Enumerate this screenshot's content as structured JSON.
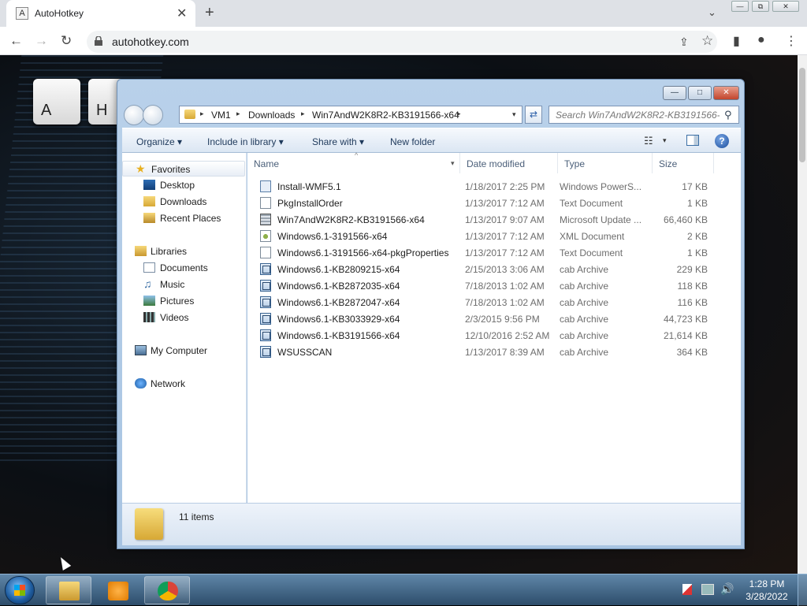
{
  "browser": {
    "tab": {
      "favicon": "A",
      "title": "AutoHotkey",
      "close": "✕"
    },
    "new_tab": "+",
    "tab_search": "⌄",
    "window_controls": {
      "minimize": "—",
      "maximize": "⧉",
      "close": "✕"
    },
    "nav": {
      "back": "←",
      "forward": "→",
      "reload": "↻"
    },
    "url": "autohotkey.com",
    "icons": {
      "share": "⇪",
      "star": "☆",
      "sidepanel": "▮",
      "profile": "●",
      "menu": "⋮"
    }
  },
  "page": {
    "keys": [
      "A",
      "H"
    ]
  },
  "explorer": {
    "caption": {
      "minimize": "—",
      "maximize": "□",
      "close": "✕"
    },
    "breadcrumb": [
      "VM1",
      "Downloads",
      "Win7AndW2K8R2-KB3191566-x64"
    ],
    "breadcrumb_sep": "▸",
    "address_dropdown": "▾",
    "refresh": "⇄",
    "search_placeholder": "Search Win7AndW2K8R2-KB3191566-...",
    "search_icon": "⚲",
    "commands": {
      "organize": "Organize",
      "include_in_library": "Include in library",
      "share_with": "Share with",
      "new_folder": "New folder",
      "dropdown": "▾"
    },
    "views_icon": "☷",
    "help": "?",
    "nav_pane": {
      "favorites": "Favorites",
      "favorites_items": [
        "Desktop",
        "Downloads",
        "Recent Places"
      ],
      "libraries": "Libraries",
      "libraries_items": [
        "Documents",
        "Music",
        "Pictures",
        "Videos"
      ],
      "computer": "My Computer",
      "network": "Network"
    },
    "columns": {
      "name": "Name",
      "date": "Date modified",
      "type": "Type",
      "size": "Size",
      "sort_indicator": "^"
    },
    "files": [
      {
        "name": "Install-WMF5.1",
        "date": "1/18/2017 2:25 PM",
        "type": "Windows PowerS...",
        "size": "17 KB",
        "icon": "ps-icon"
      },
      {
        "name": "PkgInstallOrder",
        "date": "1/13/2017 7:12 AM",
        "type": "Text Document",
        "size": "1 KB",
        "icon": "text-file-icon"
      },
      {
        "name": "Win7AndW2K8R2-KB3191566-x64",
        "date": "1/13/2017 9:07 AM",
        "type": "Microsoft Update ...",
        "size": "66,460 KB",
        "icon": "msu-icon"
      },
      {
        "name": "Windows6.1-3191566-x64",
        "date": "1/13/2017 7:12 AM",
        "type": "XML Document",
        "size": "2 KB",
        "icon": "xml-icon"
      },
      {
        "name": "Windows6.1-3191566-x64-pkgProperties",
        "date": "1/13/2017 7:12 AM",
        "type": "Text Document",
        "size": "1 KB",
        "icon": "text-file-icon"
      },
      {
        "name": "Windows6.1-KB2809215-x64",
        "date": "2/15/2013 3:06 AM",
        "type": "cab Archive",
        "size": "229 KB",
        "icon": "cab-icon"
      },
      {
        "name": "Windows6.1-KB2872035-x64",
        "date": "7/18/2013 1:02 AM",
        "type": "cab Archive",
        "size": "118 KB",
        "icon": "cab-icon"
      },
      {
        "name": "Windows6.1-KB2872047-x64",
        "date": "7/18/2013 1:02 AM",
        "type": "cab Archive",
        "size": "116 KB",
        "icon": "cab-icon"
      },
      {
        "name": "Windows6.1-KB3033929-x64",
        "date": "2/3/2015 9:56 PM",
        "type": "cab Archive",
        "size": "44,723 KB",
        "icon": "cab-icon"
      },
      {
        "name": "Windows6.1-KB3191566-x64",
        "date": "12/10/2016 2:52 AM",
        "type": "cab Archive",
        "size": "21,614 KB",
        "icon": "cab-icon"
      },
      {
        "name": "WSUSSCAN",
        "date": "1/13/2017 8:39 AM",
        "type": "cab Archive",
        "size": "364 KB",
        "icon": "cab-icon"
      }
    ],
    "status": "11 items"
  },
  "taskbar": {
    "time": "1:28 PM",
    "date": "3/28/2022",
    "volume": "🔊"
  }
}
